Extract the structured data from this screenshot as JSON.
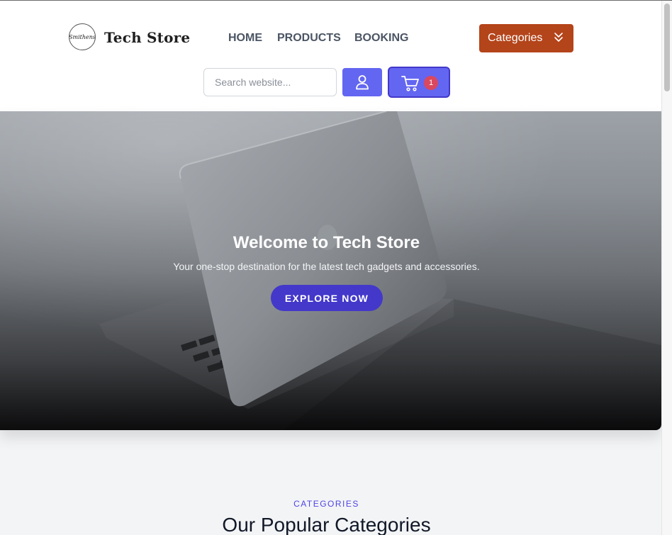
{
  "header": {
    "logo_text": "Smithens",
    "brand": "Tech Store",
    "nav": [
      {
        "label": "HOME"
      },
      {
        "label": "PRODUCTS"
      },
      {
        "label": "BOOKING"
      }
    ],
    "categories_button": "Categories",
    "search_placeholder": "Search website...",
    "cart_count": "1"
  },
  "hero": {
    "title": "Welcome to Tech Store",
    "subtitle": "Your one-stop destination for the latest tech gadgets and accessories.",
    "cta": "EXPLORE NOW"
  },
  "categories_section": {
    "label": "CATEGORIES",
    "title": "Our Popular Categories"
  },
  "colors": {
    "accent": "#6366f1",
    "accent_dark": "#4338ca",
    "categories_button": "#b4441a",
    "badge": "#d9485f",
    "page_bg": "#f3f4f6"
  },
  "icons": {
    "user": "user-icon",
    "cart": "cart-icon",
    "chevron": "double-chevron-down-icon"
  }
}
